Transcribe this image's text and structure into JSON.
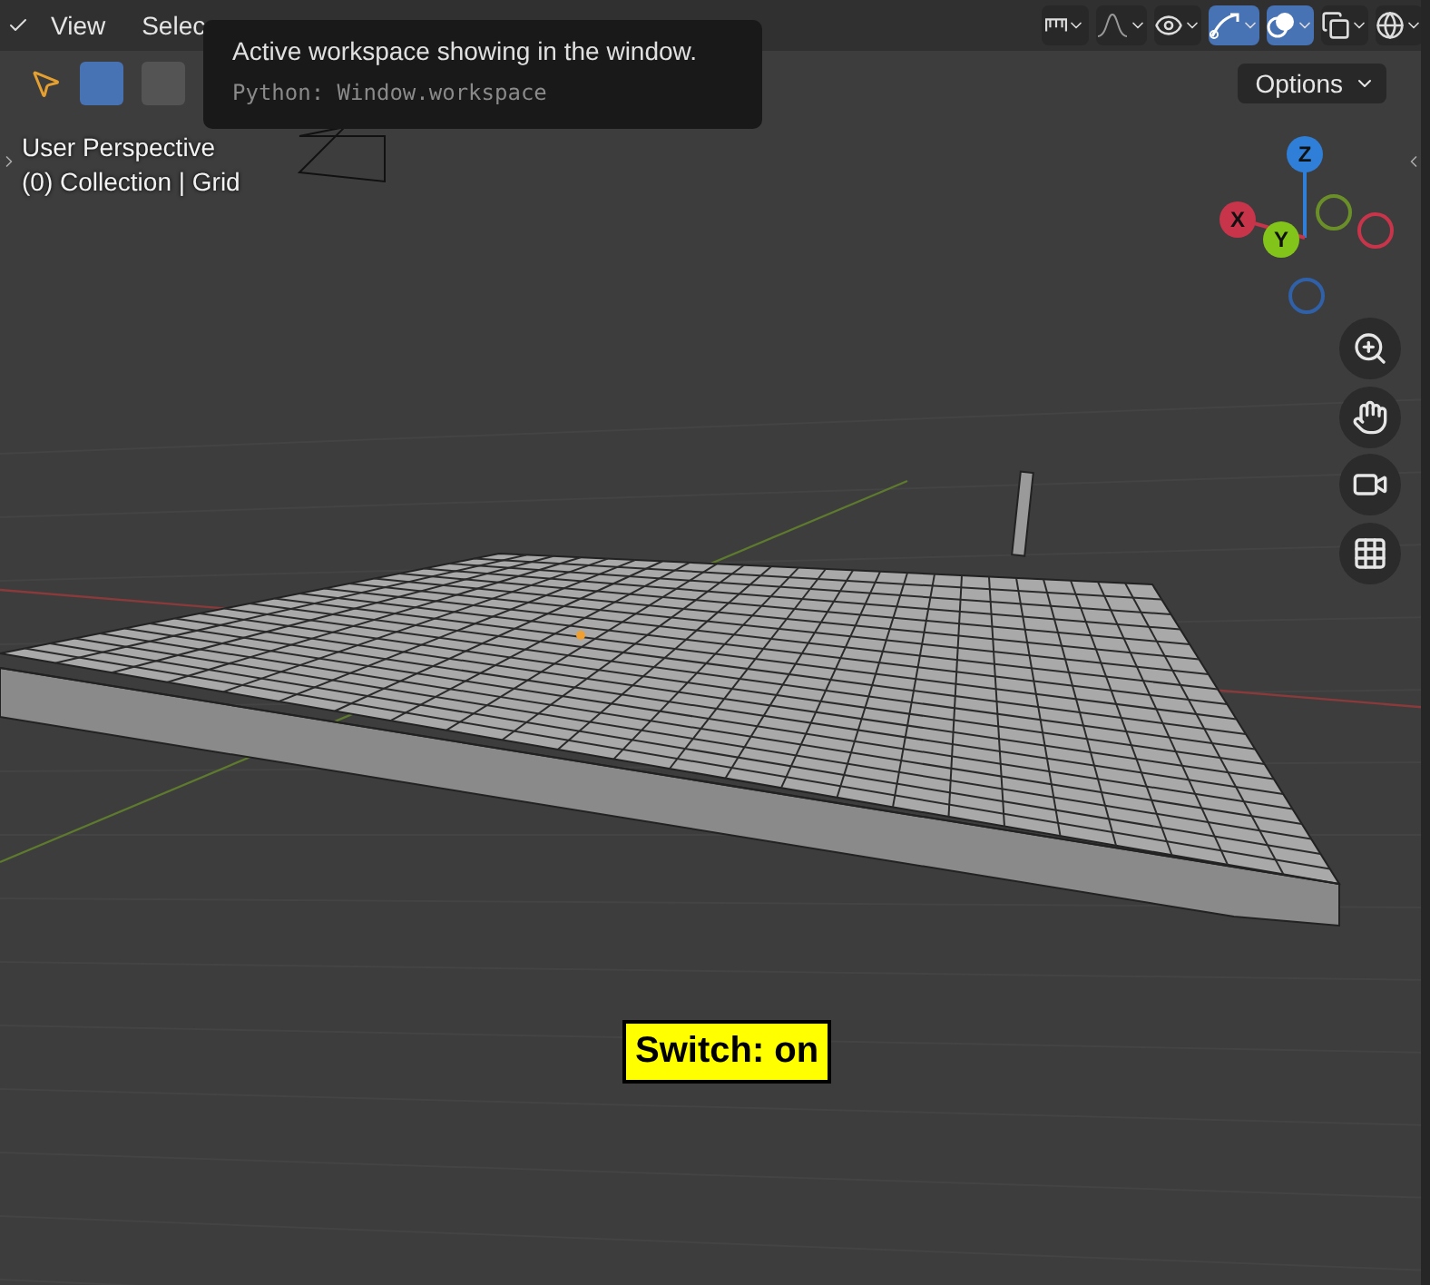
{
  "header": {
    "menus": [
      {
        "label": "View"
      },
      {
        "label": "Selec"
      }
    ],
    "toggles": [
      {
        "kind": "proportional",
        "on": false
      },
      {
        "kind": "falloff",
        "on": false
      },
      {
        "kind": "selectability",
        "on": false
      },
      {
        "kind": "gizmo",
        "on": true
      },
      {
        "kind": "overlay",
        "on": true
      },
      {
        "kind": "xray",
        "on": false
      },
      {
        "kind": "wireframe",
        "on": false
      }
    ]
  },
  "toolbar": {
    "select_modes": [
      {
        "selected": true
      },
      {
        "selected": false
      }
    ],
    "options_button": "Options"
  },
  "tooltip": {
    "text": "Active workspace showing in the window.",
    "python": "Python: Window.workspace"
  },
  "viewport": {
    "view_name": "User Perspective",
    "collection_info": "(0) Collection | Grid"
  },
  "gizmo": {
    "axes": [
      {
        "label": "Z",
        "color": "#2f7fd8"
      },
      {
        "label": "X",
        "color": "#c8344a"
      },
      {
        "label": "Y",
        "color": "#83c41a"
      }
    ]
  },
  "status_label": {
    "text": "Switch: on"
  }
}
